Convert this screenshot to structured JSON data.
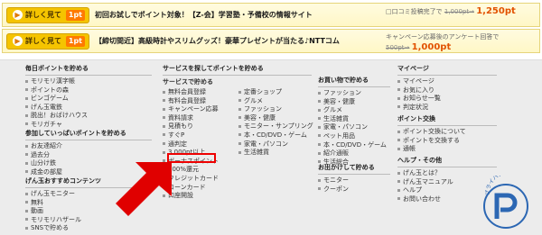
{
  "offers": [
    {
      "cta": "詳しく見て",
      "badge": "1pt",
      "title": "初回お試しでポイント対象！【Z-会】学習塾・予備校の情報サイト",
      "note": "口コミ投稿完了で",
      "old_price": "1,000pt→",
      "new_price": "1,250pt"
    },
    {
      "cta": "詳しく見て",
      "badge": "1pt",
      "title": "【締切間近】高級時計やスリムグッズ！豪華プレゼントが当たる♪NTTコム",
      "note": "キャンペーン応募後のアンケート回答で",
      "old_price": "500pt→",
      "new_price": "1,000pt"
    }
  ],
  "footer": {
    "daily": {
      "heading": "毎日ポイントを貯める",
      "items": [
        "モリモリ漢字帳",
        "ポイントの森",
        "ビンゴゲーム",
        "げん玉電鉄",
        "脱出！おばけハウス",
        "モリガチャ"
      ]
    },
    "many": {
      "heading": "参加していっぱいポイントを貯める",
      "items": [
        "お友達紹介",
        "過去分",
        "山分け鉄",
        "成金の部屋"
      ]
    },
    "contents": {
      "heading": "げん玉おすすめコンテンツ",
      "items": [
        "げん玉モニター",
        "無料",
        "動画",
        "モリモリハザール",
        "SNSで貯める"
      ]
    },
    "service": {
      "heading": "サービスを探してポイントを貯める",
      "subheading": "サービスで貯める",
      "col1": [
        "無料会員登録",
        "有料会員登録",
        "キャンペーン応募",
        "資料請求",
        "見積もり",
        "すぐP",
        "通判定",
        "3,000pt以上",
        "ボーナスポイント",
        "100%還元",
        "クレジットカード",
        "ローンカード",
        "口座開設"
      ],
      "col2": [
        "定番ショップ",
        "グルメ",
        "ファッション",
        "美容・健康",
        "モニター・サンプリング",
        "本・CD/DVD・ゲーム",
        "家電・パソコン",
        "生活雑貨"
      ]
    },
    "shopping": {
      "heading": "お買い物で貯める",
      "items": [
        "ファッション",
        "美容・健康",
        "グルメ",
        "生活雑貨",
        "家電・パソコン",
        "ペット用品",
        "本・CD/DVD・ゲーム",
        "紹介通販",
        "生活総合"
      ]
    },
    "outing": {
      "heading": "お出かけして貯める",
      "items": [
        "モニター",
        "クーポン"
      ]
    },
    "mypage": {
      "heading": "マイページ",
      "items": [
        "マイページ",
        "お気に入り",
        "お知らせ一覧",
        "判定状況"
      ]
    },
    "exchange": {
      "heading": "ポイント交換",
      "items": [
        "ポイント交換について",
        "ポイントを交換する",
        "通帳"
      ]
    },
    "help": {
      "heading": "ヘルプ・その他",
      "items": [
        "げん玉とは？",
        "げん玉マニュアル",
        "ヘルプ",
        "お問い合わせ"
      ]
    }
  },
  "logo_text": "プライバシー"
}
